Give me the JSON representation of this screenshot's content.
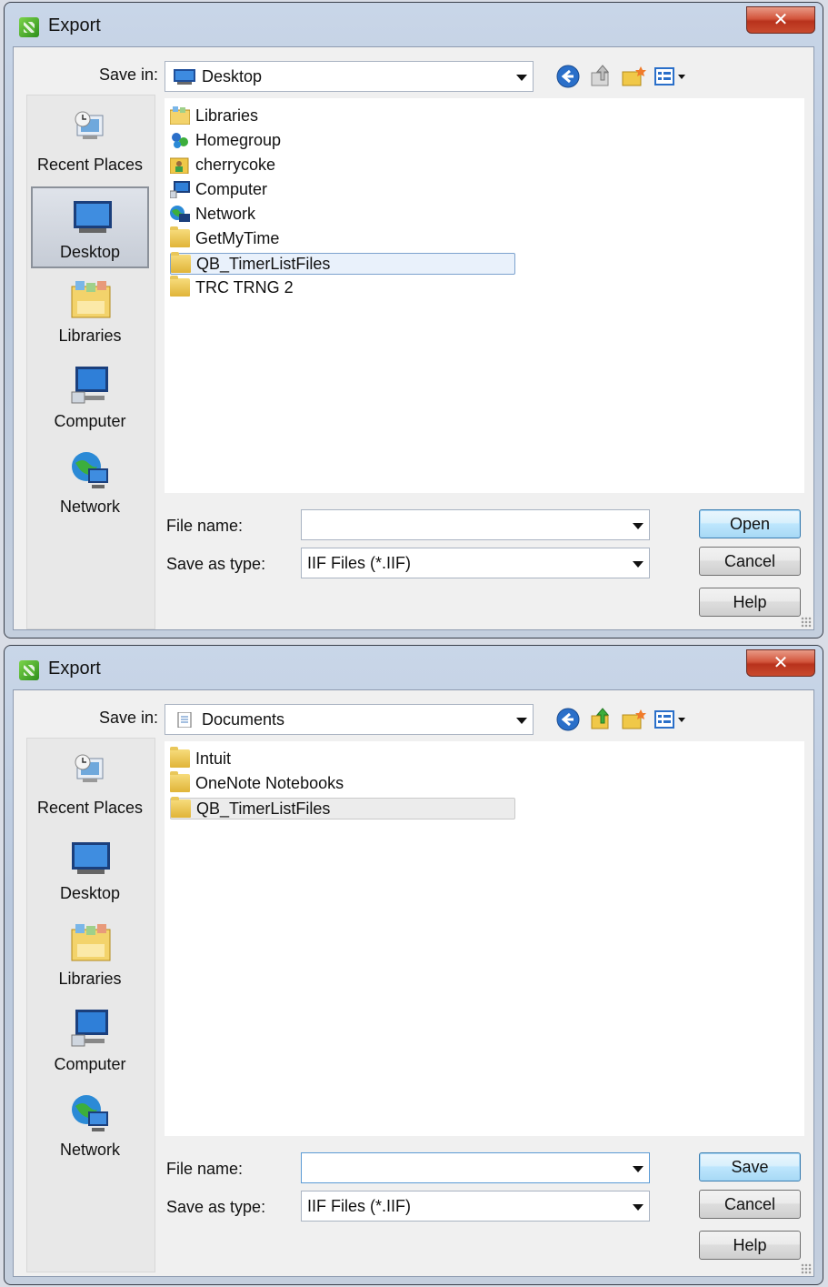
{
  "dialogs": [
    {
      "title": "Export",
      "close_label": "✕",
      "save_in_label": "Save in:",
      "save_in_value": "Desktop",
      "places": [
        "Recent Places",
        "Desktop",
        "Libraries",
        "Computer",
        "Network"
      ],
      "selected_place": "Desktop",
      "files": [
        "Libraries",
        "Homegroup",
        "cherrycoke",
        "Computer",
        "Network",
        "GetMyTime",
        "QB_TimerListFiles",
        "TRC TRNG 2"
      ],
      "selected_file": "QB_TimerListFiles",
      "file_name_label": "File name:",
      "file_name_value": "",
      "save_as_type_label": "Save as type:",
      "save_as_type_value": "IIF Files (*.IIF)",
      "primary_button": "Open",
      "cancel_button": "Cancel",
      "help_button": "Help"
    },
    {
      "title": "Export",
      "close_label": "✕",
      "save_in_label": "Save in:",
      "save_in_value": "Documents",
      "places": [
        "Recent Places",
        "Desktop",
        "Libraries",
        "Computer",
        "Network"
      ],
      "selected_place": "",
      "files": [
        "Intuit",
        "OneNote Notebooks",
        "QB_TimerListFiles"
      ],
      "selected_file": "QB_TimerListFiles",
      "file_name_label": "File name:",
      "file_name_value": "",
      "save_as_type_label": "Save as type:",
      "save_as_type_value": "IIF Files (*.IIF)",
      "primary_button": "Save",
      "cancel_button": "Cancel",
      "help_button": "Help"
    }
  ],
  "icons": {
    "app": "export-app-icon",
    "back": "back-arrow-icon",
    "up": "up-folder-icon",
    "new_folder": "new-folder-icon",
    "views": "views-menu-icon"
  },
  "colors": {
    "title_bar": "#c4cfde",
    "close_button": "#c94a2e",
    "selection": "#e9f1fb",
    "default_button": "#bee6fd"
  }
}
